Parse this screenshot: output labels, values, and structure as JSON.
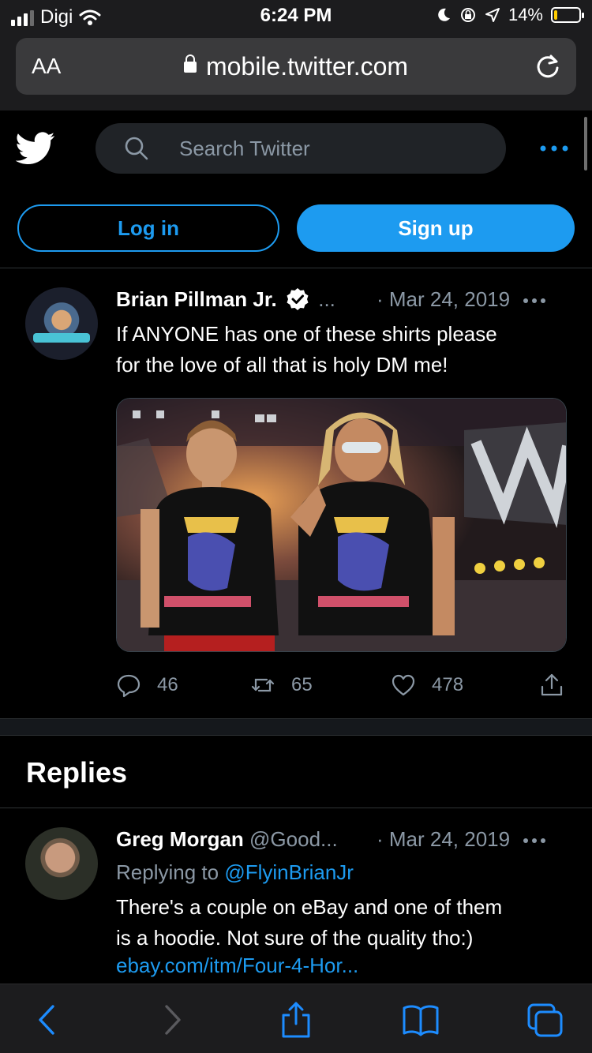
{
  "status_bar": {
    "carrier": "Digi",
    "time": "6:24 PM",
    "battery": "14%",
    "battery_level": 0.14,
    "colors": {
      "battery_fill": "#ffcc00"
    }
  },
  "browser": {
    "text_size_label": "AA",
    "address": "mobile.twitter.com",
    "icons": [
      "lock-icon",
      "reload-icon"
    ]
  },
  "header": {
    "search_placeholder": "Search Twitter",
    "login_label": "Log in",
    "signup_label": "Sign up",
    "colors": {
      "accent": "#1d9bf0"
    }
  },
  "tweet": {
    "author_name": "Brian Pillman Jr.",
    "handle_truncated": "...",
    "date": "· Mar 24, 2019",
    "text_line1": "If ANYONE has one of these shirts please",
    "text_line2": "for the love of all that is holy DM me!",
    "reply_count": "46",
    "retweet_count": "65",
    "like_count": "478"
  },
  "replies": {
    "title": "Replies",
    "items": [
      {
        "author_name": "Greg Morgan",
        "handle": "@Good...",
        "date": "· Mar 24, 2019",
        "replying_to_label": "Replying to",
        "replying_to_handle": "@FlyinBrianJr",
        "text_line1": "There's a couple on eBay and one of them",
        "text_line2": "is a hoodie.  Not sure of the quality tho:)",
        "link": "ebay.com/itm/Four-4-Hor..."
      }
    ]
  }
}
